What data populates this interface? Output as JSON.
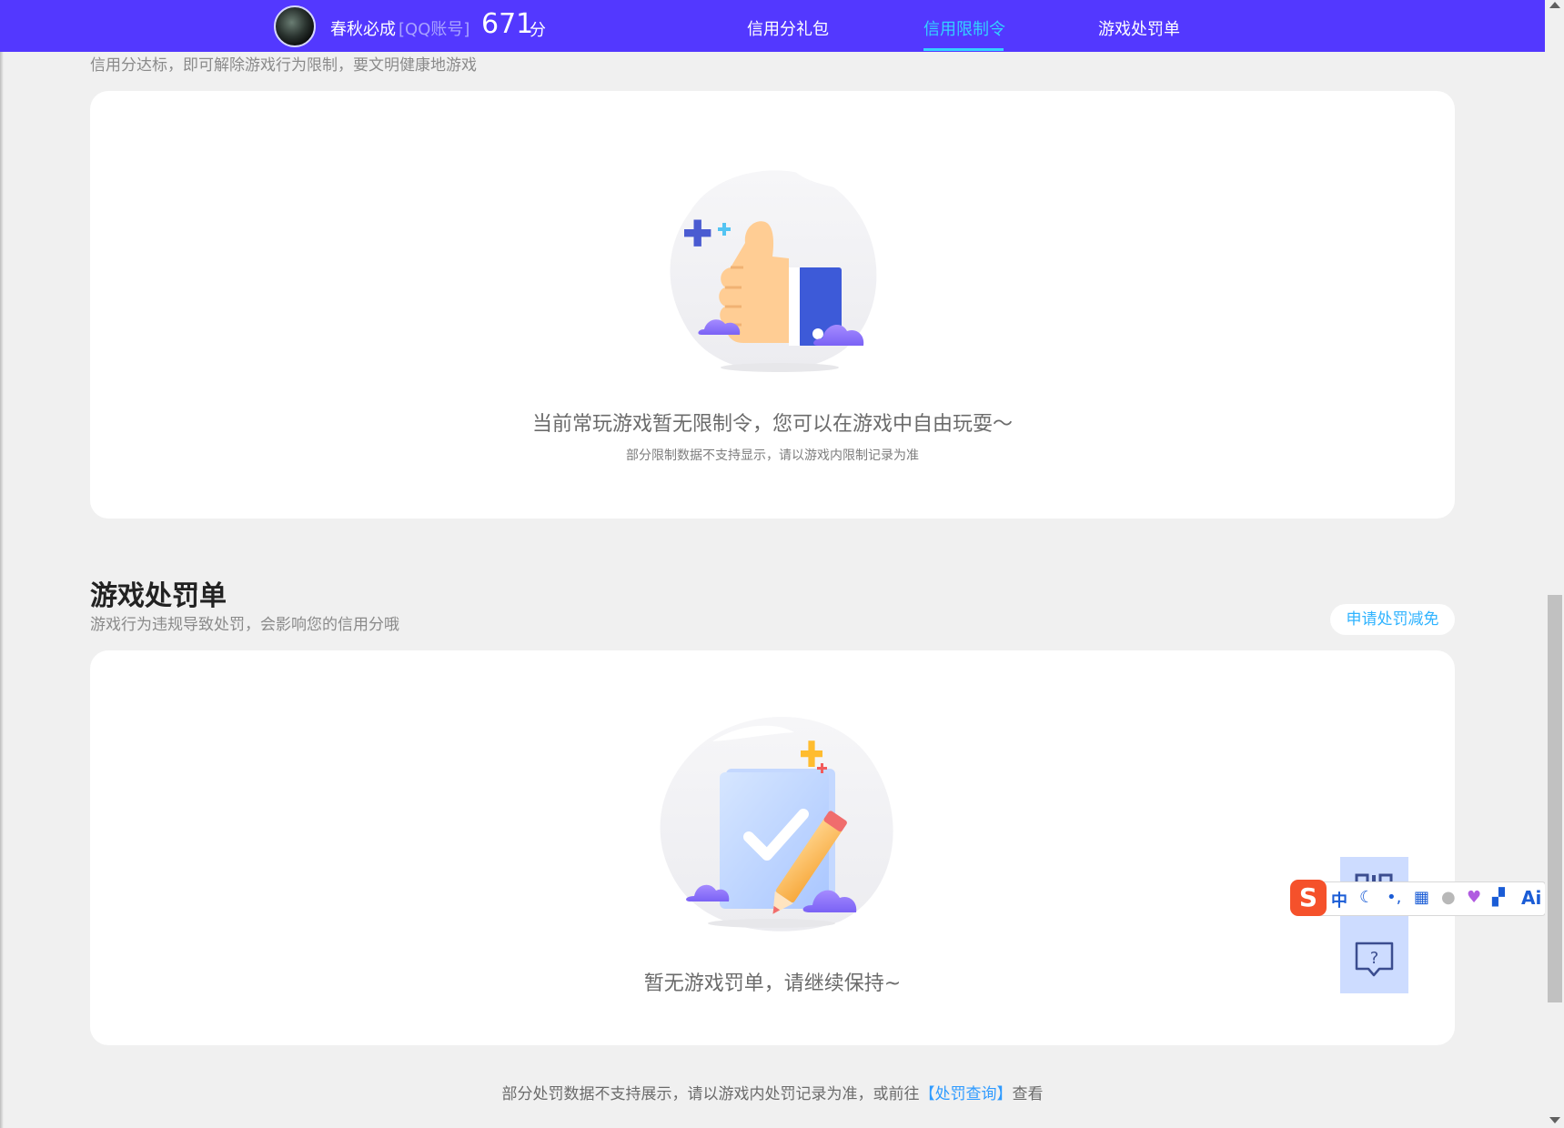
{
  "header": {
    "username": "春秋必成",
    "account_type": "[QQ账号]",
    "score": "671",
    "score_unit": "分",
    "nav": [
      "信用分礼包",
      "信用限制令",
      "游戏处罚单"
    ],
    "active_nav": "信用限制令",
    "bar_color": "#5338ff",
    "active_color": "#33d2ff"
  },
  "restriction": {
    "subtitle": "信用分达标，即可解除游戏行为限制，要文明健康地游戏",
    "empty_message": "当前常玩游戏暂无限制令，您可以在游戏中自由玩耍～",
    "empty_note": "部分限制数据不支持显示，请以游戏内限制记录为准",
    "illustration_icon": "thumbs-up-icon"
  },
  "penalty": {
    "title": "游戏处罚单",
    "subtitle": "游戏行为违规导致处罚，会影响您的信用分哦",
    "reduce_button": "申请处罚减免",
    "empty_message": "暂无游戏罚单，请继续保持~",
    "illustration_icon": "checklist-pencil-icon"
  },
  "footer": {
    "text_before": "部分处罚数据不支持展示，请以游戏内处罚记录为准，或前往",
    "link": "【处罚查询】",
    "text_after": "查看"
  },
  "floating_buttons": [
    "qr-code-icon",
    "help-feedback-icon"
  ],
  "ime_toolbar": {
    "logo": "S",
    "mode": "中",
    "ai_label": "Ai"
  }
}
